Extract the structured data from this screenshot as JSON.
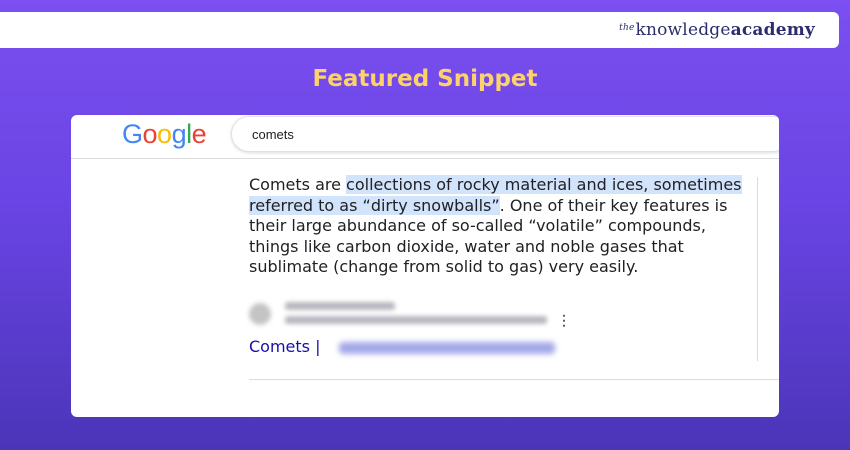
{
  "brand": {
    "prefix": "the",
    "knowledge": "knowledge",
    "academy": "academy"
  },
  "heading": "Featured Snippet",
  "google": {
    "letters": [
      {
        "char": "G",
        "color": "#4285F4"
      },
      {
        "char": "o",
        "color": "#EA4335"
      },
      {
        "char": "o",
        "color": "#FBBC05"
      },
      {
        "char": "g",
        "color": "#4285F4"
      },
      {
        "char": "l",
        "color": "#34A853"
      },
      {
        "char": "e",
        "color": "#EA4335"
      }
    ]
  },
  "search": {
    "query": "comets"
  },
  "snippet": {
    "intro": "Comets are ",
    "highlight": "collections of rocky material and ices, sometimes referred to as “dirty snowballs”",
    "rest": ". One of their key features is their large abundance of so-called “volatile” compounds, things like carbon dioxide, water and noble gases that sublimate (change from solid to gas) very easily."
  },
  "result": {
    "link_text": "Comets |",
    "more_icon": "⋮"
  },
  "colors": {
    "highlight": "#d2e3fc",
    "link": "#1a0dab",
    "heading": "#fcd36a"
  }
}
